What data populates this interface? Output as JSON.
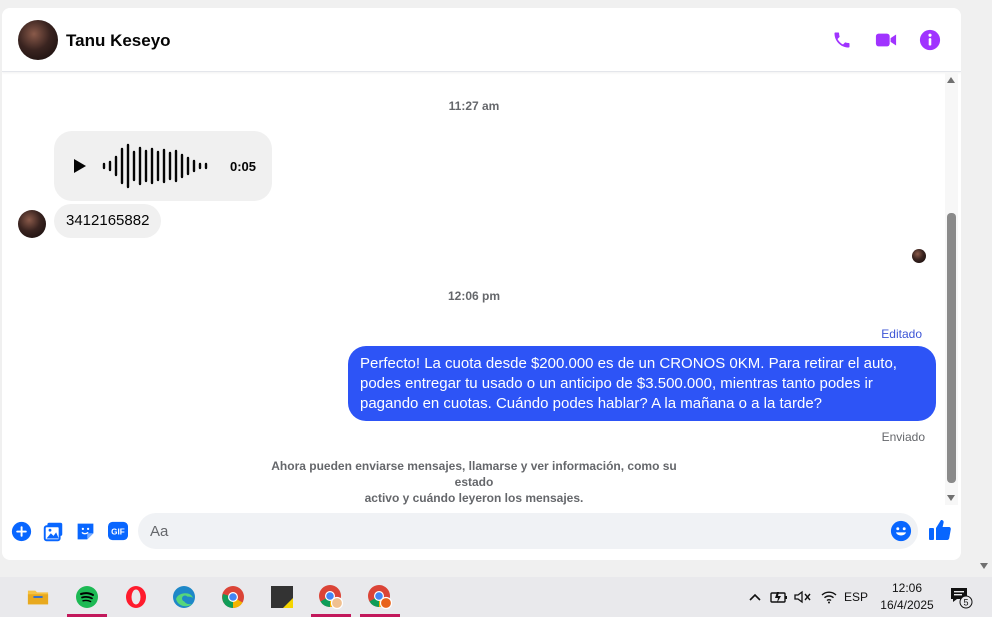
{
  "header": {
    "contact_name": "Tanu Keseyo"
  },
  "messages": {
    "ts1": "11:27 am",
    "audio_duration": "0:05",
    "incoming_text": "3412165882",
    "ts2": "12:06 pm",
    "edited_label": "Editado",
    "outgoing_text": "Perfecto! La cuota desde $200.000 es de un CRONOS 0KM. Para retirar el auto, podes entregar tu usado o un anticipo de $3.500.000, mientras tanto podes ir pagando en cuotas. Cuándo podes hablar? A la mañana o a la tarde?",
    "sent_label": "Enviado",
    "system_note_line1": "Ahora pueden enviarse mensajes, llamarse y ver información, como su estado",
    "system_note_line2": "activo y cuándo leyeron los mensajes."
  },
  "composer": {
    "placeholder": "Aa",
    "gif_label": "GIF"
  },
  "taskbar": {
    "language": "ESP",
    "time": "12:06",
    "date": "16/4/2025",
    "notification_count": "5"
  },
  "colors": {
    "accent_purple": "#a033ff",
    "composer_blue": "#0866ff",
    "bubble_blue": "#2d54f6"
  },
  "icons": [
    "phone-icon",
    "video-icon",
    "info-icon",
    "play-icon",
    "plus-icon",
    "image-icon",
    "sticker-icon",
    "gif-icon",
    "emoji-icon",
    "like-icon"
  ]
}
